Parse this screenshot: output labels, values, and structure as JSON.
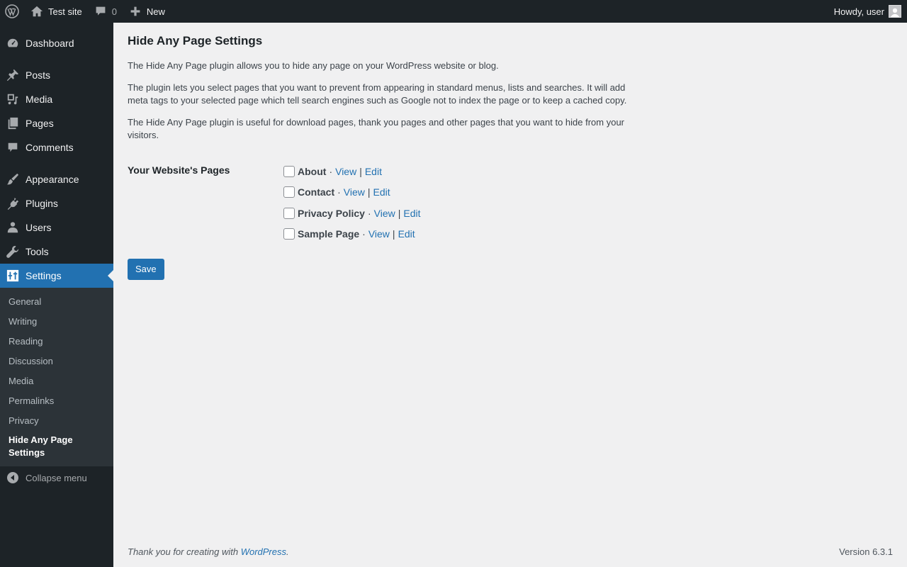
{
  "adminbar": {
    "site_name": "Test site",
    "comments_count": "0",
    "new_label": "New",
    "greeting": "Howdy, user"
  },
  "sidebar": {
    "items": [
      {
        "label": "Dashboard",
        "icon": "dashboard-icon"
      },
      {
        "label": "Posts",
        "icon": "pin-icon"
      },
      {
        "label": "Media",
        "icon": "media-icon"
      },
      {
        "label": "Pages",
        "icon": "pages-icon"
      },
      {
        "label": "Comments",
        "icon": "comment-icon"
      },
      {
        "label": "Appearance",
        "icon": "brush-icon"
      },
      {
        "label": "Plugins",
        "icon": "plug-icon"
      },
      {
        "label": "Users",
        "icon": "user-icon"
      },
      {
        "label": "Tools",
        "icon": "wrench-icon"
      },
      {
        "label": "Settings",
        "icon": "settings-icon"
      }
    ],
    "settings_submenu": [
      "General",
      "Writing",
      "Reading",
      "Discussion",
      "Media",
      "Permalinks",
      "Privacy",
      "Hide Any Page Settings"
    ],
    "collapse_label": "Collapse menu"
  },
  "main": {
    "title": "Hide Any Page Settings",
    "descriptions": [
      "The Hide Any Page plugin allows you to hide any page on your WordPress website or blog.",
      "The plugin lets you select pages that you want to prevent from appearing in standard menus, lists and searches. It will add meta tags to your selected page which tell search engines such as Google not to index the page or to keep a cached copy.",
      "The Hide Any Page plugin is useful for download pages, thank you pages and other pages that you want to hide from your visitors."
    ],
    "pages_label": "Your Website's Pages",
    "pages": [
      {
        "name": "About",
        "view": "View",
        "edit": "Edit",
        "checked": false
      },
      {
        "name": "Contact",
        "view": "View",
        "edit": "Edit",
        "checked": false
      },
      {
        "name": "Privacy Policy",
        "view": "View",
        "edit": "Edit",
        "checked": false
      },
      {
        "name": "Sample Page",
        "view": "View",
        "edit": "Edit",
        "checked": false
      }
    ],
    "save_label": "Save"
  },
  "footer": {
    "thanks_prefix": "Thank you for creating with ",
    "thanks_link": "WordPress",
    "thanks_suffix": ".",
    "version": "Version 6.3.1"
  },
  "colors": {
    "accent": "#2271b1",
    "adminbar_bg": "#1d2327",
    "content_bg": "#f0f0f1"
  }
}
